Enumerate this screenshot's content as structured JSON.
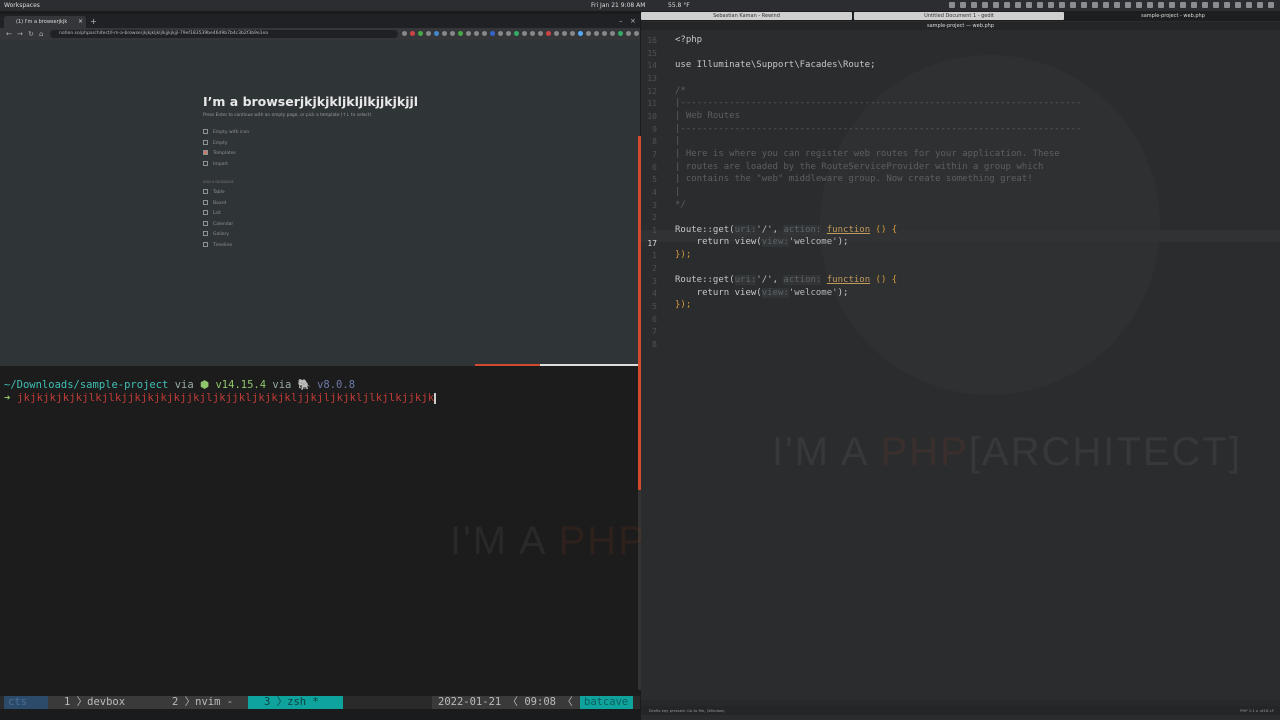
{
  "topbar": {
    "workspaces": "Workspaces",
    "clock": "Fri Jan 21  9:08 AM",
    "weather": "55.8 °F"
  },
  "browser": {
    "tab_title": "(1) I'm a browserjkjk",
    "new_tab": "+",
    "url": "notion.so/phparchitect/I-m-a-browserjkjkjkljkljlkjjkjkjjl-79ef183539be46d9b7b4c3b2f3b9e1ea",
    "page_title": "I’m a browserjkjkjkljkljlkjjkjkjjl",
    "hint": "Press Enter to continue with an empty page, or pick a template (↑↓ to select)",
    "options": [
      "Empty with icon",
      "Empty",
      "Templates",
      "Import"
    ],
    "section_label": "Add a database",
    "databases": [
      "Table",
      "Board",
      "List",
      "Calendar",
      "Gallery",
      "Timeline"
    ]
  },
  "terminal": {
    "path": "~/Downloads/sample-project",
    "via1": "via",
    "node_version": "⬢ v14.15.4",
    "via2": "via",
    "php_version": "🐘 v8.0.8",
    "prompt": "➜",
    "input": " jkjkjkjkjkjlkjlkjjkjkjkjkjjkjljkjjkljkjkjkljjkjljkjkljlkjlkjjkjk"
  },
  "tmux": {
    "session": "cts",
    "w1": "1 〉devbox",
    "w2": "2 〉nvim -",
    "w3": "3 〉zsh *",
    "datetime": "2022-01-21 〈 09:08 〈",
    "host": "batcave"
  },
  "editor": {
    "tabs": [
      "Sebastian Kaman - Rewind",
      "Untitled Document 1 - gedit",
      "sample-project - web.php"
    ],
    "title": "sample-project — web.php",
    "gutter": [
      "16",
      "15",
      "14",
      "13",
      "12",
      "11",
      "10",
      "9",
      "8",
      "7",
      "6",
      "5",
      "4",
      "3",
      "2",
      "1",
      "17",
      "1",
      "2",
      "3",
      "4",
      "5",
      "6",
      "7",
      "8"
    ],
    "lines": {
      "l1": "<?php",
      "l3": "use Illuminate\\Support\\Facades\\Route;",
      "l5": "/*",
      "l6": "|--------------------------------------------------------------------------",
      "l7": "| Web Routes",
      "l8": "|--------------------------------------------------------------------------",
      "l9": "|",
      "l10": "| Here is where you can register web routes for your application. These",
      "l11": "| routes are loaded by the RouteServiceProvider within a group which",
      "l12": "| contains the \"web\" middleware group. Now create something great!",
      "l13": "|",
      "l14": "*/",
      "route": "Route",
      "get": "::get(",
      "hint_url": "uri:",
      "url_val": "'/'",
      "comma": ",",
      "hint_action": "action:",
      "function": "function",
      "paren": " () {",
      "ret": "    return view(",
      "hint_view": "view:",
      "view_val": "'welcome'",
      "end_ret": ");",
      "close": "});"
    },
    "watermark_a": "I'M A ",
    "watermark_b": "PHP",
    "watermark_c": "[ARCHITECT]",
    "status_left": "Drafts key pressed: Go to file, (Window)",
    "status_right": "PHP  1:1  ⌂ utf-8  LF"
  },
  "term_watermark_a": "I'M A ",
  "term_watermark_b": "PHP[A"
}
